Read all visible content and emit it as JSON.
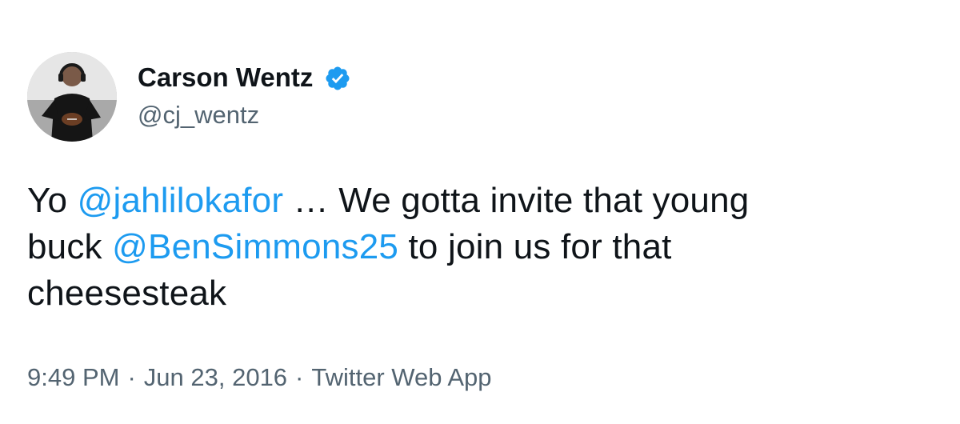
{
  "author": {
    "display_name": "Carson Wentz",
    "handle": "@cj_wentz",
    "verified": true
  },
  "tweet": {
    "line1_prefix": "Yo ",
    "mention1": "@jahlilokafor",
    "line1_suffix": " … We gotta invite that young",
    "line2_prefix": "buck ",
    "mention2": "@BenSimmons25",
    "line2_suffix": " to join us for that",
    "line3": "cheesesteak"
  },
  "meta": {
    "time": "9:49 PM",
    "separator": "·",
    "date": "Jun 23, 2016",
    "source": "Twitter Web App"
  },
  "colors": {
    "link": "#1d9bf0",
    "text": "#0f1419",
    "secondary": "#536471"
  }
}
